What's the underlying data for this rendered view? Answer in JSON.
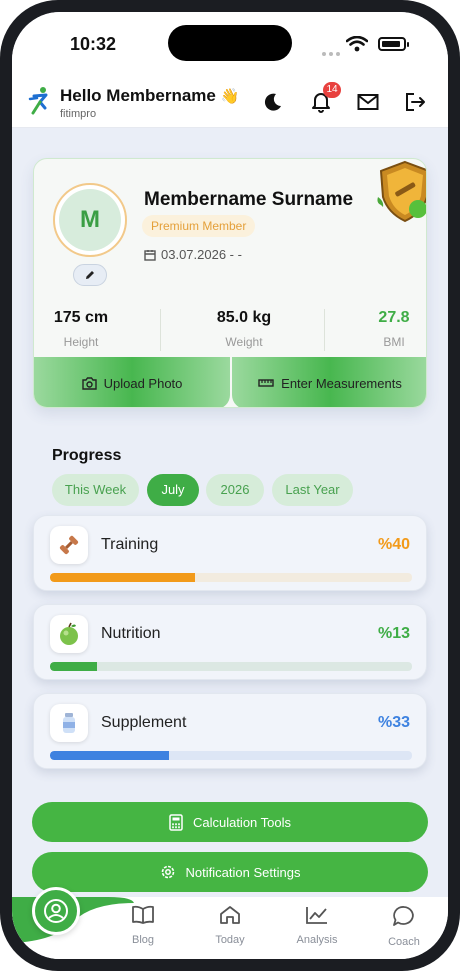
{
  "status": {
    "time": "10:32"
  },
  "header": {
    "greeting": "Hello Membername",
    "greeting_emoji": "👋",
    "brand": "fitimpro",
    "notification_count": "14"
  },
  "profile": {
    "avatar_initial": "M",
    "name": "Membername Surname",
    "badge": "Premium Member",
    "date_range": "03.07.2026  -  -",
    "stats": [
      {
        "value": "175 cm",
        "label": "Height"
      },
      {
        "value": "85.0 kg",
        "label": "Weight"
      },
      {
        "value": "27.8",
        "label": "BMI",
        "color": "#3fad46"
      }
    ],
    "upload_photo": "Upload Photo",
    "enter_measurements": "Enter Measurements"
  },
  "progress": {
    "title": "Progress",
    "filters": [
      "This Week",
      "July",
      "2026",
      "Last Year"
    ],
    "active_filter": "July",
    "items": [
      {
        "name": "Training",
        "percent_label": "%40",
        "percent": 40,
        "color": "#f29a1a",
        "track": "#f2ebdf",
        "icon": "dumbbell-icon"
      },
      {
        "name": "Nutrition",
        "percent_label": "%13",
        "percent": 13,
        "color": "#3fad46",
        "track": "#dce8e3",
        "icon": "apple-icon"
      },
      {
        "name": "Supplement",
        "percent_label": "%33",
        "percent": 33,
        "color": "#3e82e0",
        "track": "#dde6f5",
        "icon": "supplement-bottle-icon"
      }
    ]
  },
  "actions": {
    "calculation_tools": "Calculation Tools",
    "notification_settings": "Notification Settings"
  },
  "tabs": [
    {
      "label": "Blog",
      "icon": "book-icon"
    },
    {
      "label": "Today",
      "icon": "home-icon"
    },
    {
      "label": "Analysis",
      "icon": "chart-icon"
    },
    {
      "label": "Coach",
      "icon": "chat-bubble-icon"
    }
  ],
  "colors": {
    "accent": "#3fad46",
    "premium": "#e4a03a"
  }
}
